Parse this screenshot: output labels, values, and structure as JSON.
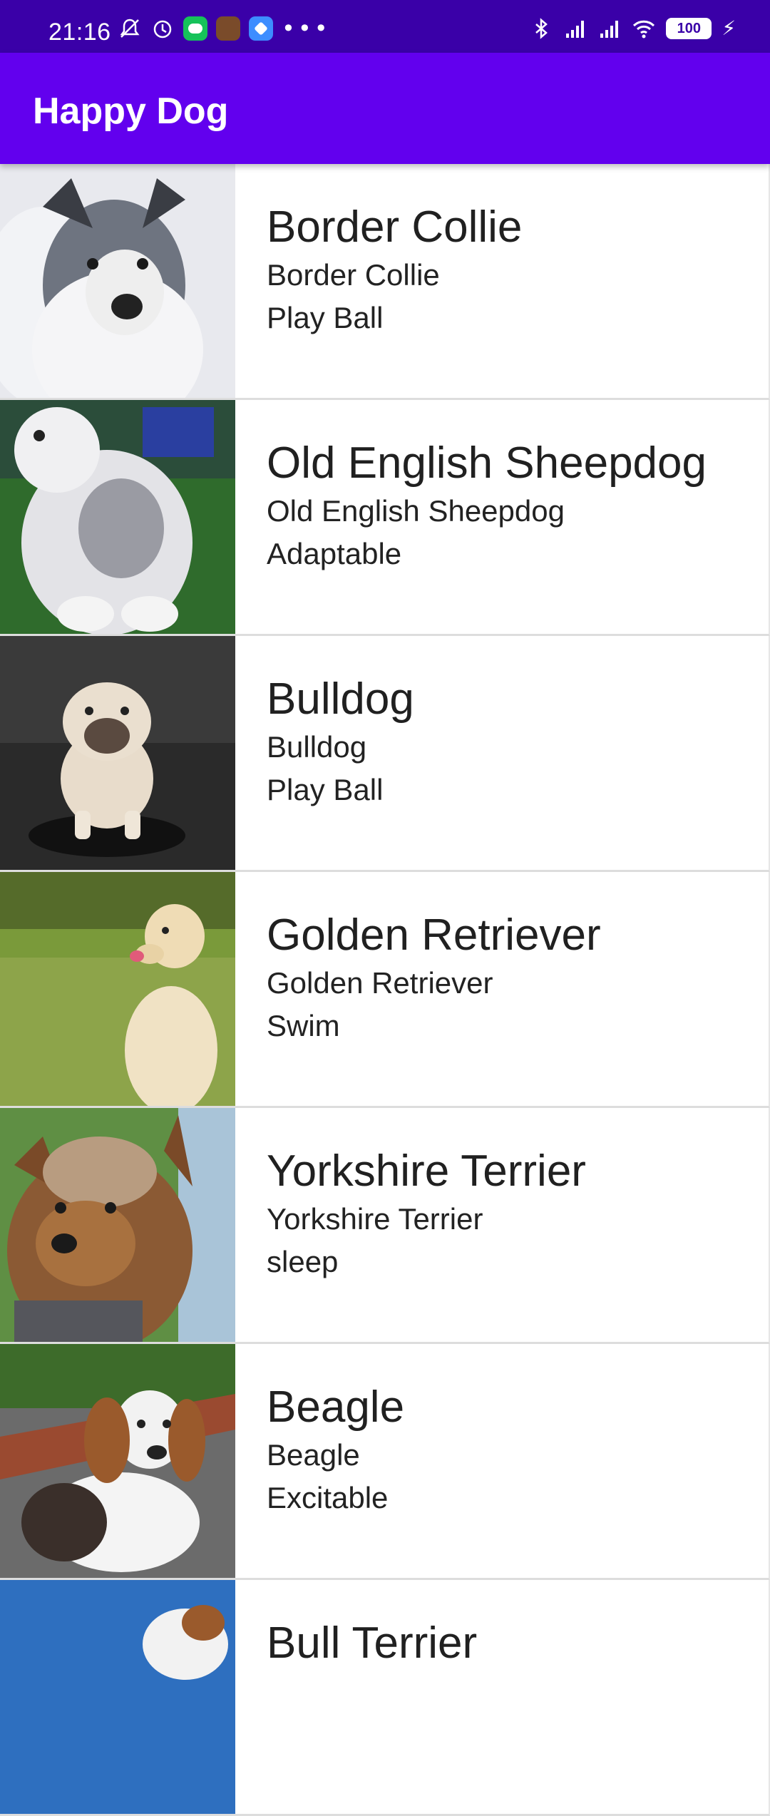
{
  "status_bar": {
    "time": "21:16",
    "battery": "100",
    "icons_left": [
      "mute-bell-icon",
      "alarm-icon",
      "wechat-icon",
      "game-icon",
      "app-icon",
      "more-dots-icon"
    ],
    "icons_right": [
      "bluetooth-icon",
      "signal-icon",
      "hd-signal-icon",
      "wifi-icon",
      "battery-icon",
      "charging-icon"
    ],
    "overflow": "•••"
  },
  "app_bar": {
    "title": "Happy Dog",
    "color": "#6200ee"
  },
  "dogs": [
    {
      "name": "Border Collie",
      "breed": "Border Collie",
      "hobby": "Play Ball",
      "photo": "border-collie-photo"
    },
    {
      "name": "Old English Sheepdog",
      "breed": "Old English Sheepdog",
      "hobby": "Adaptable",
      "photo": "sheepdog-photo"
    },
    {
      "name": "Bulldog",
      "breed": "Bulldog",
      "hobby": "Play Ball",
      "photo": "bulldog-photo"
    },
    {
      "name": "Golden Retriever",
      "breed": "Golden Retriever",
      "hobby": "Swim",
      "photo": "golden-retriever-photo"
    },
    {
      "name": "Yorkshire Terrier",
      "breed": "Yorkshire Terrier",
      "hobby": "sleep",
      "photo": "yorkshire-terrier-photo"
    },
    {
      "name": "Beagle",
      "breed": "Beagle",
      "hobby": "Excitable",
      "photo": "beagle-photo"
    },
    {
      "name": "Bull Terrier",
      "breed": "",
      "hobby": "",
      "photo": "bull-terrier-photo"
    }
  ]
}
